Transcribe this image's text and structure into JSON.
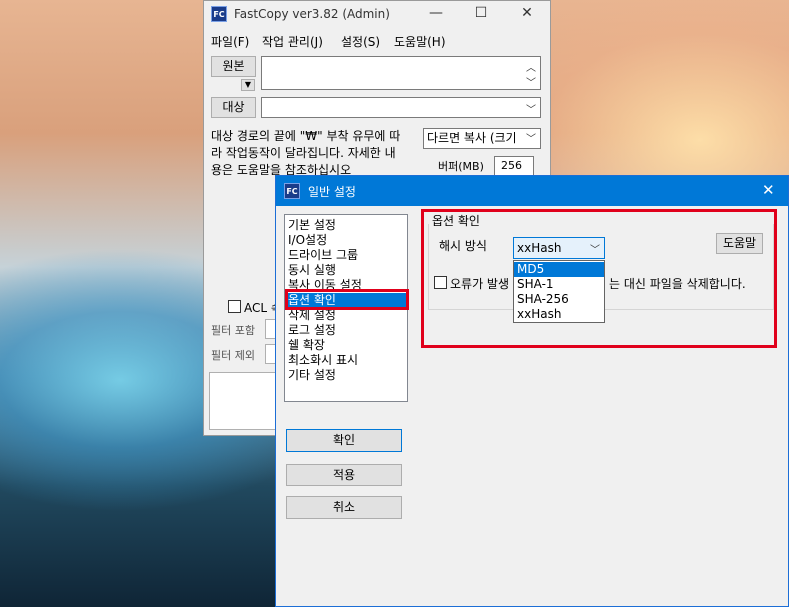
{
  "main_window": {
    "app_icon": "FC",
    "title": "FastCopy ver3.82 (Admin)",
    "controls": {
      "minimize": "—",
      "maximize": "☐",
      "close": "✕"
    },
    "menu": [
      "파일(F)",
      "작업 관리(J)",
      "설정(S)",
      "도움말(H)"
    ],
    "source_label": "원본",
    "dest_label": "대상",
    "info_lines": [
      "대상 경로의 끝에 \"₩\" 부착 유무에 따",
      "라 작업동작이 달라집니다. 자세한 내",
      "용은  도움말을 참조하십시오"
    ],
    "mode_select": "다르면 복사 (크기",
    "buffer_label": "버퍼(MB)",
    "buffer_value": "256",
    "acl_label": "ACL 속",
    "filter_include": "필터 포함",
    "filter_exclude": "필터 제외"
  },
  "dialog": {
    "app_icon": "FC",
    "title": "일반 설정",
    "close": "✕",
    "categories": [
      "기본 설정",
      "I/O설정",
      "드라이브 그룹",
      "동시 실행",
      "복사 이동 설정",
      "옵션 확인",
      "삭제 설정",
      "로그 설정",
      "쉘 확장",
      "최소화시 표시",
      "기타 설정"
    ],
    "selected_index": 5,
    "section_title": "옵션 확인",
    "hash_label": "해시 방식",
    "hash_value": "xxHash",
    "hash_options": [
      "MD5",
      "SHA-1",
      "SHA-256",
      "xxHash"
    ],
    "hash_highlight_index": 0,
    "help_button": "도움말",
    "error_checkbox_left": "오류가 발생",
    "error_checkbox_right": "는 대신 파일을 삭제합니다.",
    "ok_button": "확인",
    "apply_button": "적용",
    "cancel_button": "취소"
  },
  "colors": {
    "accent": "#0078d7",
    "highlight_box": "#e0001b"
  }
}
